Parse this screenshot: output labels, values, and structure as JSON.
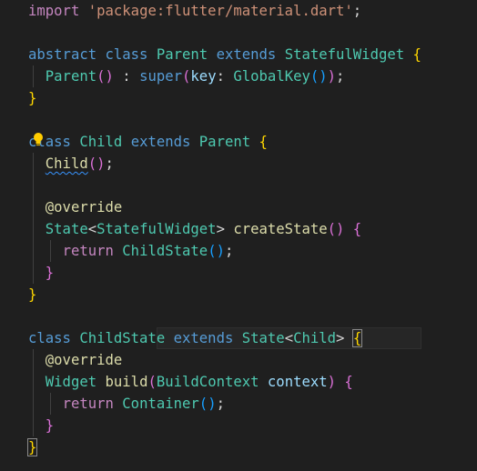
{
  "colors": {
    "background": "#1f1f1f",
    "keyword": "#569cd6",
    "type": "#4ec9b0",
    "function": "#dcdcaa",
    "string": "#ce9178",
    "parameter": "#9cdcfe",
    "bracket_level1": "#ffd700",
    "bracket_level2": "#da70d6",
    "bracket_level3": "#179fff",
    "squiggle": "#3794ff",
    "lightbulb": "#ffcc00"
  },
  "icons": {
    "lightbulb": "lightbulb-icon"
  },
  "code": {
    "l1": {
      "import": "import",
      "space": " ",
      "path": "'package:flutter/material.dart'",
      "semi": ";"
    },
    "l3": {
      "abstract": "abstract",
      "class": "class",
      "name": "Parent",
      "extends": "extends",
      "super_type": "StatefulWidget",
      "brace": "{"
    },
    "l4": {
      "ctor": "Parent",
      "paren_open": "(",
      "paren_close": ")",
      "colon": " : ",
      "super": "super",
      "p_open": "(",
      "key": "key",
      "key_colon": ": ",
      "gk": "GlobalKey",
      "gk_open": "(",
      "gk_close": ")",
      "p_close": ")",
      "semi": ";"
    },
    "l5": {
      "brace": "}"
    },
    "l7": {
      "class": "class",
      "name": "Child",
      "extends": "extends",
      "super_type": "Parent",
      "brace": "{"
    },
    "l8": {
      "ctor": "Child",
      "paren_open": "(",
      "paren_close": ")",
      "semi": ";"
    },
    "l10": {
      "override": "@override"
    },
    "l11": {
      "state": "State",
      "lt": "<",
      "sw": "StatefulWidget",
      "gt": ">",
      "method": "createState",
      "paren_open": "(",
      "paren_close": ")",
      "brace": "{"
    },
    "l12": {
      "return": "return",
      "ctor": "ChildState",
      "paren_open": "(",
      "paren_close": ")",
      "semi": ";"
    },
    "l13": {
      "brace": "}"
    },
    "l14": {
      "brace": "}"
    },
    "l16": {
      "class": "class",
      "name": "ChildState",
      "extends": "extends",
      "state": "State",
      "lt": "<",
      "child": "Child",
      "gt": ">",
      "brace": "{"
    },
    "l17": {
      "override": "@override"
    },
    "l18": {
      "type": "Widget",
      "method": "build",
      "paren_open": "(",
      "ptype": "BuildContext",
      "pname": "context",
      "paren_close": ")",
      "brace": "{"
    },
    "l19": {
      "return": "return",
      "ctor": "Container",
      "paren_open": "(",
      "paren_close": ")",
      "semi": ";"
    },
    "l20": {
      "brace": "}"
    },
    "l21": {
      "brace": "}"
    }
  }
}
